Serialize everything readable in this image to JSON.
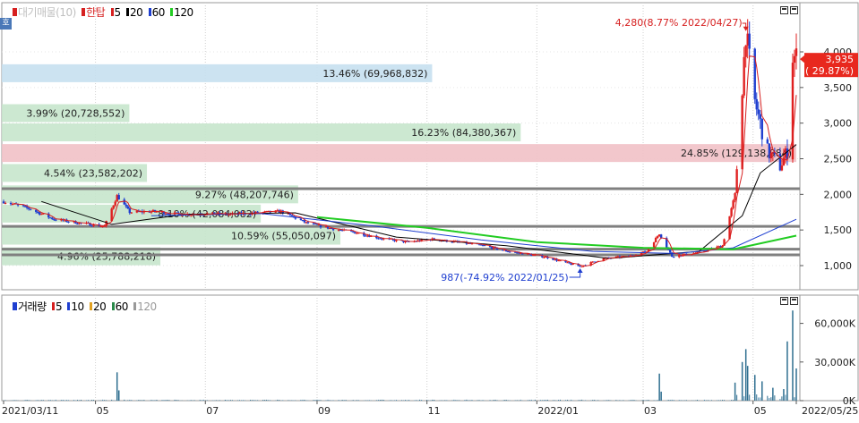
{
  "legend_price": {
    "title": "대기매물(10)",
    "items": [
      {
        "label": "한탑",
        "color": "#d62020"
      },
      {
        "label": "5",
        "color": "#d62020"
      },
      {
        "label": "20",
        "color": "#000000"
      },
      {
        "label": "60",
        "color": "#1f3fd0"
      },
      {
        "label": "120",
        "color": "#22cc22"
      }
    ]
  },
  "legend_volume": {
    "title": "거래량",
    "items": [
      {
        "label": "5",
        "color": "#d62020"
      },
      {
        "label": "10",
        "color": "#1f3fd0"
      },
      {
        "label": "20",
        "color": "#e0a020"
      },
      {
        "label": "60",
        "color": "#2a8a4a"
      },
      {
        "label": "120",
        "color": "#9a9a9a"
      }
    ]
  },
  "pin_label": "호",
  "colors": {
    "up": "#e02020",
    "down": "#1f3fd0",
    "ma5": "#d62020",
    "ma20": "#000000",
    "ma60": "#1f3fd0",
    "ma120": "#22cc22",
    "profile_green": "#c7e6cc",
    "profile_blue": "#c6e0ef",
    "profile_red": "#f1c1c6",
    "hline": "#808080"
  },
  "chart_data": [
    {
      "type": "candlestick",
      "name": "price",
      "ylim": [
        600,
        4500
      ],
      "y_ticks": [
        1000,
        1500,
        2000,
        2500,
        3000,
        3500,
        4000
      ],
      "y_tick_labels": [
        "1,000",
        "1,500",
        "2,000",
        "2,500",
        "3,000",
        "3,500",
        "4,000"
      ],
      "x_date_range": [
        "2021-03-11",
        "2022-05-25"
      ],
      "x_tick_labels": [
        {
          "date": "2021-03-11",
          "label": "2021/03/11"
        },
        {
          "date": "2021-05-01",
          "label": "05"
        },
        {
          "date": "2021-07-01",
          "label": "07"
        },
        {
          "date": "2021-09-01",
          "label": "09"
        },
        {
          "date": "2021-11-01",
          "label": "11"
        },
        {
          "date": "2022-01-01",
          "label": "2022/01"
        },
        {
          "date": "2022-03-01",
          "label": "03"
        },
        {
          "date": "2022-05-01",
          "label": "05"
        },
        {
          "date": "2022-05-25",
          "label": "2022/05/25"
        }
      ],
      "price_path": [
        [
          "2021-03-11",
          1900
        ],
        [
          "2021-03-25",
          1800
        ],
        [
          "2021-04-08",
          1650
        ],
        [
          "2021-04-22",
          1600
        ],
        [
          "2021-05-06",
          1550
        ],
        [
          "2021-05-13",
          1980
        ],
        [
          "2021-05-20",
          1750
        ],
        [
          "2021-06-03",
          1760
        ],
        [
          "2021-06-17",
          1720
        ],
        [
          "2021-07-01",
          1730
        ],
        [
          "2021-07-15",
          1720
        ],
        [
          "2021-07-29",
          1740
        ],
        [
          "2021-08-12",
          1760
        ],
        [
          "2021-08-26",
          1600
        ],
        [
          "2021-09-09",
          1520
        ],
        [
          "2021-09-23",
          1460
        ],
        [
          "2021-10-07",
          1380
        ],
        [
          "2021-10-21",
          1330
        ],
        [
          "2021-11-04",
          1370
        ],
        [
          "2021-11-18",
          1330
        ],
        [
          "2021-12-02",
          1280
        ],
        [
          "2021-12-16",
          1200
        ],
        [
          "2022-01-06",
          1120
        ],
        [
          "2022-01-20",
          1020
        ],
        [
          "2022-01-25",
          987
        ],
        [
          "2022-02-07",
          1100
        ],
        [
          "2022-02-21",
          1130
        ],
        [
          "2022-03-03",
          1200
        ],
        [
          "2022-03-10",
          1450
        ],
        [
          "2022-03-17",
          1130
        ],
        [
          "2022-03-31",
          1180
        ],
        [
          "2022-04-14",
          1280
        ],
        [
          "2022-04-21",
          2000
        ],
        [
          "2022-04-27",
          4280
        ],
        [
          "2022-05-02",
          3300
        ],
        [
          "2022-05-09",
          2600
        ],
        [
          "2022-05-16",
          2400
        ],
        [
          "2022-05-20",
          2600
        ],
        [
          "2022-05-23",
          3935
        ],
        [
          "2022-05-25",
          3935
        ]
      ],
      "moving_averages": [
        {
          "name": "20",
          "points": [
            [
              "2021-04-01",
              1900
            ],
            [
              "2021-05-10",
              1580
            ],
            [
              "2021-06-20",
              1720
            ],
            [
              "2021-08-20",
              1740
            ],
            [
              "2021-10-15",
              1400
            ],
            [
              "2021-12-15",
              1280
            ],
            [
              "2022-02-10",
              1100
            ],
            [
              "2022-04-01",
              1200
            ],
            [
              "2022-04-25",
              1700
            ],
            [
              "2022-05-05",
              2300
            ],
            [
              "2022-05-25",
              2700
            ]
          ]
        },
        {
          "name": "60",
          "points": [
            [
              "2021-06-01",
              1700
            ],
            [
              "2021-08-01",
              1730
            ],
            [
              "2021-10-01",
              1560
            ],
            [
              "2021-12-01",
              1360
            ],
            [
              "2022-02-01",
              1200
            ],
            [
              "2022-03-20",
              1170
            ],
            [
              "2022-04-20",
              1250
            ],
            [
              "2022-05-25",
              1650
            ]
          ]
        },
        {
          "name": "120",
          "points": [
            [
              "2021-09-01",
              1680
            ],
            [
              "2021-11-01",
              1530
            ],
            [
              "2022-01-01",
              1330
            ],
            [
              "2022-03-01",
              1250
            ],
            [
              "2022-04-20",
              1230
            ],
            [
              "2022-05-25",
              1420
            ]
          ]
        }
      ],
      "volume_profile": [
        {
          "label": "13.46% (69,968,832)",
          "y": 3700,
          "share": 13.46,
          "color": "blue"
        },
        {
          "label": "3.99% (20,728,552)",
          "y": 3140,
          "share": 3.99,
          "color": "green"
        },
        {
          "label": "16.23% (84,380,367)",
          "y": 2870,
          "share": 16.23,
          "color": "green"
        },
        {
          "label": "24.85% (129,138,984)",
          "y": 2580,
          "share": 24.85,
          "color": "red"
        },
        {
          "label": "4.54% (23,582,202)",
          "y": 2300,
          "share": 4.54,
          "color": "green"
        },
        {
          "label": "9.27% (48,207,746)",
          "y": 2000,
          "share": 9.27,
          "color": "green"
        },
        {
          "label": "8.10% (42,084,082)",
          "y": 1730,
          "share": 8.1,
          "color": "green"
        },
        {
          "label": "10.59% (55,050,097)",
          "y": 1420,
          "share": 10.59,
          "color": "green"
        },
        {
          "label": "4.96% (25,788,218)",
          "y": 1130,
          "share": 4.96,
          "color": "green"
        }
      ],
      "horizontal_lines": [
        2080,
        1550,
        1230,
        1150
      ],
      "annotations": {
        "high": {
          "label": "4,280(8.77% 2022/04/27)",
          "date": "2022-04-27",
          "value": 4280
        },
        "low": {
          "label": "987(-74.92% 2022/01/25)",
          "date": "2022-01-25",
          "value": 987
        }
      },
      "current_price": {
        "line1": "3,935",
        "line2": "( 29.87%)",
        "value": 3935
      }
    },
    {
      "type": "bar",
      "name": "volume",
      "ylim": [
        0,
        75000
      ],
      "y_ticks": [
        0,
        30000,
        60000
      ],
      "y_tick_labels": [
        "0K",
        "30,000K",
        "60,000K"
      ],
      "spikes": [
        [
          "2021-05-13",
          22000
        ],
        [
          "2021-05-14",
          8000
        ],
        [
          "2022-03-10",
          21000
        ],
        [
          "2022-03-11",
          7000
        ],
        [
          "2022-04-21",
          14000
        ],
        [
          "2022-04-25",
          30000
        ],
        [
          "2022-04-27",
          40000
        ],
        [
          "2022-04-28",
          27000
        ],
        [
          "2022-05-02",
          20000
        ],
        [
          "2022-05-06",
          15000
        ],
        [
          "2022-05-12",
          10000
        ],
        [
          "2022-05-18",
          9000
        ],
        [
          "2022-05-20",
          46000
        ],
        [
          "2022-05-23",
          70000
        ],
        [
          "2022-05-25",
          25000
        ]
      ]
    }
  ]
}
